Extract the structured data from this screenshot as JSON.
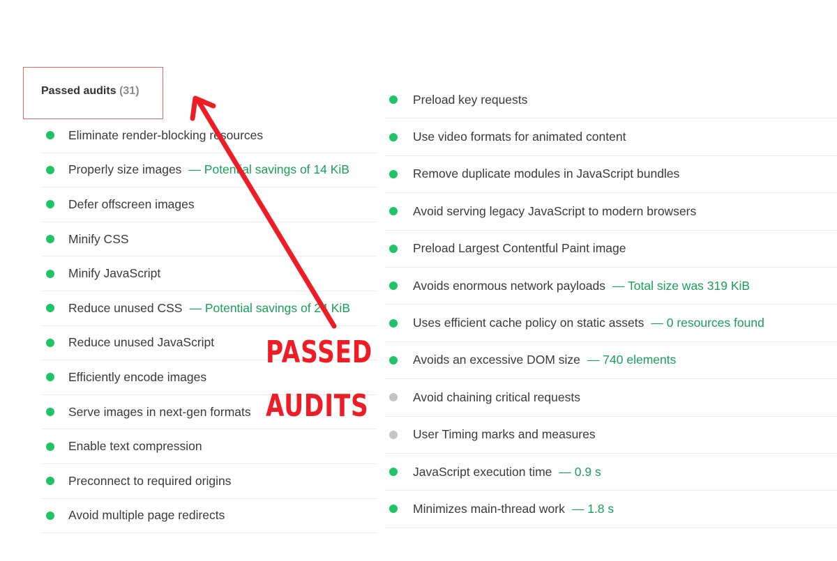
{
  "header": {
    "title": "Passed audits",
    "count": "(31)"
  },
  "colors": {
    "pass": "#1ec465",
    "informative": "#c4c4c4",
    "detail_text": "#18a058",
    "annotation": "#ee1c24"
  },
  "left_audits": [
    {
      "title": "Eliminate render-blocking resources",
      "detail": "",
      "status": "pass"
    },
    {
      "title": "Properly size images",
      "detail": "— Potential savings of 14 KiB",
      "status": "pass"
    },
    {
      "title": "Defer offscreen images",
      "detail": "",
      "status": "pass"
    },
    {
      "title": "Minify CSS",
      "detail": "",
      "status": "pass"
    },
    {
      "title": "Minify JavaScript",
      "detail": "",
      "status": "pass"
    },
    {
      "title": "Reduce unused CSS",
      "detail": "— Potential savings of 24 KiB",
      "status": "pass"
    },
    {
      "title": "Reduce unused JavaScript",
      "detail": "",
      "status": "pass"
    },
    {
      "title": "Efficiently encode images",
      "detail": "",
      "status": "pass"
    },
    {
      "title": "Serve images in next-gen formats",
      "detail": "",
      "status": "pass"
    },
    {
      "title": "Enable text compression",
      "detail": "",
      "status": "pass"
    },
    {
      "title": "Preconnect to required origins",
      "detail": "",
      "status": "pass"
    },
    {
      "title": "Avoid multiple page redirects",
      "detail": "",
      "status": "pass"
    }
  ],
  "right_audits": [
    {
      "title": "Preload key requests",
      "detail": "",
      "status": "pass"
    },
    {
      "title": "Use video formats for animated content",
      "detail": "",
      "status": "pass"
    },
    {
      "title": "Remove duplicate modules in JavaScript bundles",
      "detail": "",
      "status": "pass"
    },
    {
      "title": "Avoid serving legacy JavaScript to modern browsers",
      "detail": "",
      "status": "pass"
    },
    {
      "title": "Preload Largest Contentful Paint image",
      "detail": "",
      "status": "pass"
    },
    {
      "title": "Avoids enormous network payloads",
      "detail": "— Total size was 319 KiB",
      "status": "pass"
    },
    {
      "title": "Uses efficient cache policy on static assets",
      "detail": "— 0 resources found",
      "status": "pass"
    },
    {
      "title": "Avoids an excessive DOM size",
      "detail": "— 740 elements",
      "status": "pass"
    },
    {
      "title": "Avoid chaining critical requests",
      "detail": "",
      "status": "informative"
    },
    {
      "title": "User Timing marks and measures",
      "detail": "",
      "status": "informative"
    },
    {
      "title": "JavaScript execution time",
      "detail": "— 0.9 s",
      "status": "pass"
    },
    {
      "title": "Minimizes main-thread work",
      "detail": "— 1.8 s",
      "status": "pass"
    }
  ],
  "annotation": {
    "line1": "PASSED",
    "line2": "AUDITS",
    "arrow_icon": "red-arrow-pointing-to-header"
  }
}
